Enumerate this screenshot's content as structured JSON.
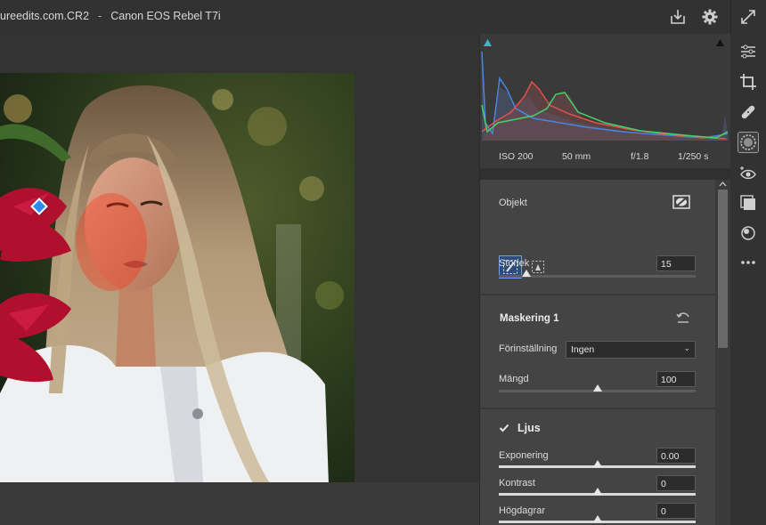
{
  "window": {
    "filename": "ureedits.com.CR2",
    "separator": "-",
    "camera": "Canon EOS Rebel T7i"
  },
  "icons": {
    "toolbar": [
      "export-icon",
      "gear-icon",
      "expand-icon"
    ],
    "tools": [
      "edit-sliders-icon",
      "crop-icon",
      "heal-icon",
      "mask-icon",
      "red-eye-icon",
      "presets-icon",
      "snapshot-icon",
      "more-icon"
    ]
  },
  "exif": {
    "iso": "ISO 200",
    "focal": "50 mm",
    "aperture": "f/1.8",
    "shutter": "1/250 s"
  },
  "object_section": {
    "title": "Objekt",
    "size_label": "Storlek",
    "size_value": "15",
    "size_level": 0.14
  },
  "mask_section": {
    "title": "Maskering 1",
    "preset_label": "Förinställning",
    "preset_value": "Ingen",
    "amount_label": "Mängd",
    "amount_value": "100",
    "amount_level": 0.5
  },
  "light_section": {
    "title": "Ljus",
    "exposure_label": "Exponering",
    "exposure_value": "0.00",
    "contrast_label": "Kontrast",
    "contrast_value": "0",
    "highlights_label": "Högdagrar",
    "highlights_value": "0"
  },
  "colors": {
    "accent": "#2f8bf0",
    "panel": "#444444",
    "background": "#2b2b2b"
  }
}
